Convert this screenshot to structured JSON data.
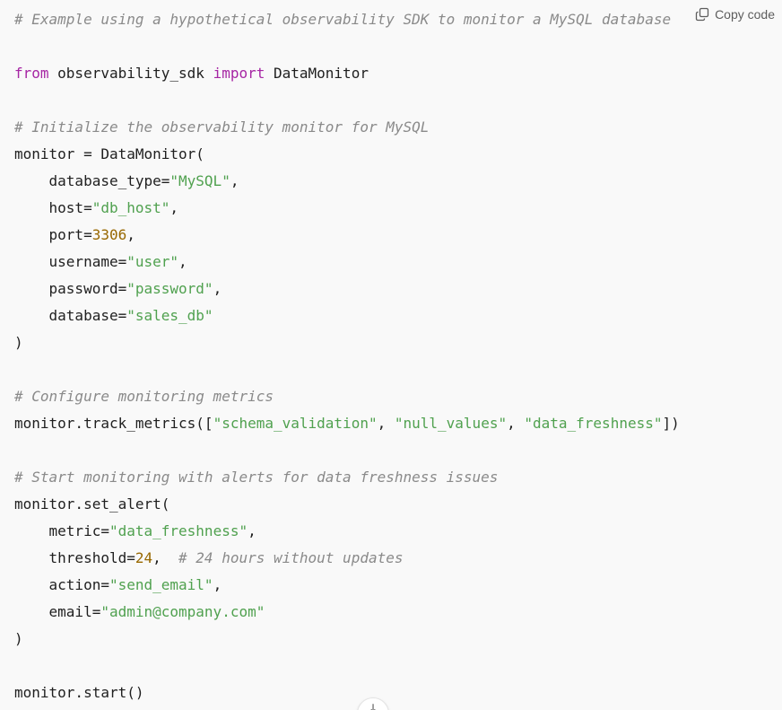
{
  "toolbar": {
    "copy_label": "Copy code",
    "copy_icon": "copy-icon"
  },
  "code": {
    "lines": [
      [
        {
          "t": "# Example using a hypothetical observability SDK to monitor a MySQL database",
          "k": "comment"
        }
      ],
      [],
      [
        {
          "t": "from",
          "k": "keyword"
        },
        {
          "t": " observability_sdk ",
          "k": "plain"
        },
        {
          "t": "import",
          "k": "keyword"
        },
        {
          "t": " DataMonitor",
          "k": "plain"
        }
      ],
      [],
      [
        {
          "t": "# Initialize the observability monitor for MySQL",
          "k": "comment"
        }
      ],
      [
        {
          "t": "monitor = DataMonitor(",
          "k": "plain"
        }
      ],
      [
        {
          "t": "    database_type=",
          "k": "plain"
        },
        {
          "t": "\"MySQL\"",
          "k": "string"
        },
        {
          "t": ",",
          "k": "plain"
        }
      ],
      [
        {
          "t": "    host=",
          "k": "plain"
        },
        {
          "t": "\"db_host\"",
          "k": "string"
        },
        {
          "t": ",",
          "k": "plain"
        }
      ],
      [
        {
          "t": "    port=",
          "k": "plain"
        },
        {
          "t": "3306",
          "k": "number"
        },
        {
          "t": ",",
          "k": "plain"
        }
      ],
      [
        {
          "t": "    username=",
          "k": "plain"
        },
        {
          "t": "\"user\"",
          "k": "string"
        },
        {
          "t": ",",
          "k": "plain"
        }
      ],
      [
        {
          "t": "    password=",
          "k": "plain"
        },
        {
          "t": "\"password\"",
          "k": "string"
        },
        {
          "t": ",",
          "k": "plain"
        }
      ],
      [
        {
          "t": "    database=",
          "k": "plain"
        },
        {
          "t": "\"sales_db\"",
          "k": "string"
        }
      ],
      [
        {
          "t": ")",
          "k": "plain"
        }
      ],
      [],
      [
        {
          "t": "# Configure monitoring metrics",
          "k": "comment"
        }
      ],
      [
        {
          "t": "monitor.track_metrics([",
          "k": "plain"
        },
        {
          "t": "\"schema_validation\"",
          "k": "string"
        },
        {
          "t": ", ",
          "k": "plain"
        },
        {
          "t": "\"null_values\"",
          "k": "string"
        },
        {
          "t": ", ",
          "k": "plain"
        },
        {
          "t": "\"data_freshness\"",
          "k": "string"
        },
        {
          "t": "])",
          "k": "plain"
        }
      ],
      [],
      [
        {
          "t": "# Start monitoring with alerts for data freshness issues",
          "k": "comment"
        }
      ],
      [
        {
          "t": "monitor.set_alert(",
          "k": "plain"
        }
      ],
      [
        {
          "t": "    metric=",
          "k": "plain"
        },
        {
          "t": "\"data_freshness\"",
          "k": "string"
        },
        {
          "t": ",",
          "k": "plain"
        }
      ],
      [
        {
          "t": "    threshold=",
          "k": "plain"
        },
        {
          "t": "24",
          "k": "number"
        },
        {
          "t": ",  ",
          "k": "plain"
        },
        {
          "t": "# 24 hours without updates",
          "k": "comment"
        }
      ],
      [
        {
          "t": "    action=",
          "k": "plain"
        },
        {
          "t": "\"send_email\"",
          "k": "string"
        },
        {
          "t": ",",
          "k": "plain"
        }
      ],
      [
        {
          "t": "    email=",
          "k": "plain"
        },
        {
          "t": "\"admin@company.com\"",
          "k": "string"
        }
      ],
      [
        {
          "t": ")",
          "k": "plain"
        }
      ],
      [],
      [
        {
          "t": "monitor.start()",
          "k": "plain"
        }
      ]
    ]
  },
  "scroll_button": {
    "icon": "arrow-down-icon",
    "glyph": "↓"
  }
}
